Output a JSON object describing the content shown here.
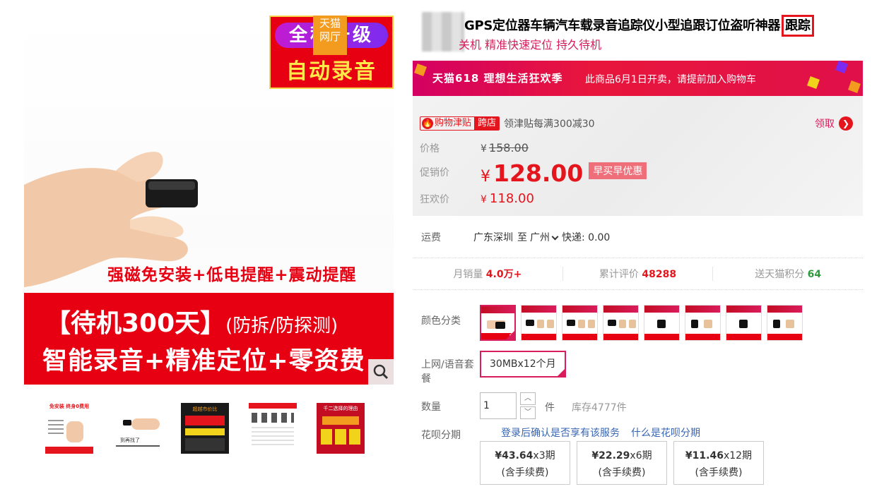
{
  "gallery": {
    "promo_tag_top": "全程一级",
    "promo_tag_bottom": "自动录音",
    "tmall_badge": [
      "天猫",
      "网厅"
    ],
    "slogan_line1": "强磁免安装+低电提醒+震动提醒",
    "slogan_line2_main": "【待机300天】",
    "slogan_line2_sub": "(防拆/防探测)",
    "slogan_line3": "智能录音+精准定位+零资费",
    "zoom_icon": "search-icon",
    "thumbnails": [
      {
        "caption": "免安装 终身0费用"
      },
      {
        "caption": "到再找了"
      },
      {
        "caption": "超越市价比"
      },
      {
        "caption": ""
      },
      {
        "caption": "千二选择的理由"
      }
    ]
  },
  "product": {
    "title_main": "GPS定位器车辆汽车载录音追踪仪小型追跟订位盗听神器",
    "title_highlight": "跟踪",
    "subtitle": "关机 精准快速定位 持久待机"
  },
  "promo_bar": {
    "logo": "天猫618 理想生活狂欢季",
    "text": "此商品6月1日开卖，请提前加入购物车"
  },
  "coupon": {
    "badge_left": "购物津贴",
    "badge_right": "跨店",
    "desc": "领津贴每满300减30",
    "action": "领取"
  },
  "price": {
    "orig_label": "价格",
    "orig_currency": "¥",
    "orig_value": "158.00",
    "promo_label": "促销价",
    "promo_currency": "¥",
    "promo_value": "128.00",
    "promo_badge": "早买早优惠",
    "fest_label": "狂欢价",
    "fest_currency": "¥",
    "fest_value": "118.00"
  },
  "shipping": {
    "label": "运费",
    "from": "广东深圳",
    "to_word": "至",
    "to": "广州",
    "express": "快递: 0.00"
  },
  "stats": {
    "monthly_label": "月销量",
    "monthly_value": "4.0万+",
    "reviews_label": "累计评价",
    "reviews_value": "48288",
    "points_label": "送天猫积分",
    "points_value": "64"
  },
  "options": {
    "color_label": "颜色分类",
    "color_count": 8,
    "selected_color_index": 0,
    "plan_label": "上网/语音套餐",
    "plan_value": "30MBx12个月",
    "qty_label": "数量",
    "qty_value": "1",
    "qty_unit": "件",
    "qty_stock": "库存4777件",
    "huabei_label": "花呗分期",
    "huabei_note": "登录后确认是否享有该服务",
    "huabei_link": "什么是花呗分期",
    "installments": [
      {
        "amount": "¥43.64",
        "period": "x3期",
        "fee": "(含手续费)"
      },
      {
        "amount": "¥22.29",
        "period": "x6期",
        "fee": "(含手续费)"
      },
      {
        "amount": "¥11.46",
        "period": "x12期",
        "fee": "(含手续费)"
      }
    ]
  },
  "colors": {
    "accent": "#e4151c",
    "brand_pink": "#d91c5c",
    "link": "#3665b3",
    "points_green": "#2d9a3b"
  }
}
